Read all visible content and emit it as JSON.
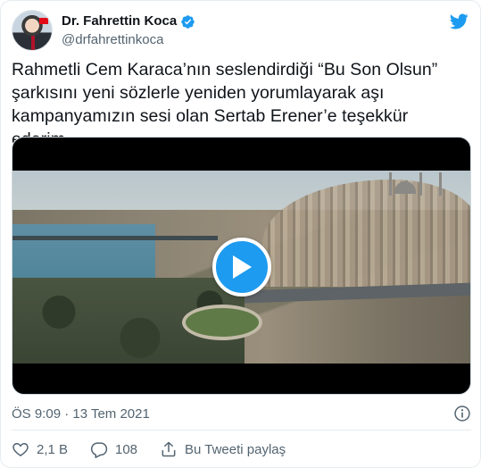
{
  "author": {
    "display_name": "Dr. Fahrettin Koca",
    "handle": "@drfahrettinkoca",
    "verified": true
  },
  "tweet": {
    "text": "Rahmetli Cem Karaca’nın seslendirdiği “Bu Son Olsun” şarkısını yeni sözlerle yeniden yorumlayarak aşı kampanyamızın sesi olan Sertab Erener’e teşekkür ederim.",
    "timestamp": "ÖS 9:09 · 13 Tem 2021"
  },
  "media": {
    "type": "video",
    "play_icon": "play-icon"
  },
  "actions": {
    "like_count": "2,1 B",
    "reply_count": "108",
    "share_label": "Bu Tweeti paylaş"
  },
  "colors": {
    "accent": "#1d9bf0",
    "text": "#0f1419",
    "secondary_text": "#536471",
    "border": "#e6ecf0"
  },
  "icons": [
    "twitter-bird-icon",
    "verified-badge-icon",
    "play-icon",
    "info-icon",
    "heart-icon",
    "reply-icon",
    "share-icon"
  ]
}
